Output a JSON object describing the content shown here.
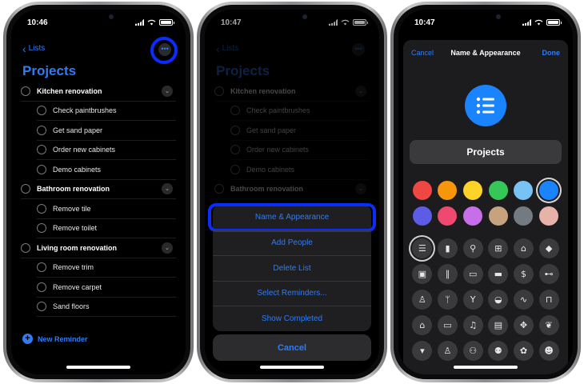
{
  "panel1": {
    "time": "10:46",
    "back_label": "Lists",
    "more_label": "•••",
    "title": "Projects",
    "rows": [
      {
        "label": "Kitchen renovation",
        "type": "parent"
      },
      {
        "label": "Check paintbrushes",
        "type": "child"
      },
      {
        "label": "Get sand paper",
        "type": "child"
      },
      {
        "label": "Order new cabinets",
        "type": "child"
      },
      {
        "label": "Demo cabinets",
        "type": "child"
      },
      {
        "label": "Bathroom renovation",
        "type": "parent"
      },
      {
        "label": "Remove tile",
        "type": "child"
      },
      {
        "label": "Remove toilet",
        "type": "child"
      },
      {
        "label": "Living room renovation",
        "type": "parent"
      },
      {
        "label": "Remove trim",
        "type": "child"
      },
      {
        "label": "Remove carpet",
        "type": "child"
      },
      {
        "label": "Sand floors",
        "type": "child"
      }
    ],
    "new_reminder": "New Reminder"
  },
  "panel2": {
    "time": "10:47",
    "back_label": "Lists",
    "more_label": "•••",
    "title": "Projects",
    "rows": [
      {
        "label": "Kitchen renovation",
        "type": "parent"
      },
      {
        "label": "Check paintbrushes",
        "type": "child"
      },
      {
        "label": "Get sand paper",
        "type": "child"
      },
      {
        "label": "Order new cabinets",
        "type": "child"
      },
      {
        "label": "Demo cabinets",
        "type": "child"
      },
      {
        "label": "Bathroom renovation",
        "type": "parent"
      }
    ],
    "sheet": [
      "Name & Appearance",
      "Add People",
      "Delete List",
      "Select Reminders...",
      "Show Completed"
    ],
    "cancel": "Cancel"
  },
  "panel3": {
    "time": "10:47",
    "cancel": "Cancel",
    "title": "Name & Appearance",
    "done": "Done",
    "list_name": "Projects",
    "colors": [
      "#ef4743",
      "#f7960a",
      "#fdd32a",
      "#36c759",
      "#79c2f6",
      "#1a84ff",
      "#5d5ce6",
      "#ee4a70",
      "#c76fe8",
      "#c6a27e",
      "#747a82",
      "#e7b3a8"
    ],
    "selected_color": 5,
    "icons": [
      {
        "name": "list-icon",
        "glyph": "☰"
      },
      {
        "name": "bookmark-icon",
        "glyph": "▮"
      },
      {
        "name": "pin-icon",
        "glyph": "⚲"
      },
      {
        "name": "gift-icon",
        "glyph": "⊞"
      },
      {
        "name": "cake-icon",
        "glyph": "⌂"
      },
      {
        "name": "graduation-cap-icon",
        "glyph": "◆"
      },
      {
        "name": "backpack-icon",
        "glyph": "▣"
      },
      {
        "name": "pencil-ruler-icon",
        "glyph": "∥"
      },
      {
        "name": "credit-card-icon",
        "glyph": "▭"
      },
      {
        "name": "card-icon",
        "glyph": "▬"
      },
      {
        "name": "money-icon",
        "glyph": "$"
      },
      {
        "name": "dumbbell-icon",
        "glyph": "⊷"
      },
      {
        "name": "running-icon",
        "glyph": "♙"
      },
      {
        "name": "fork-knife-icon",
        "glyph": "ᛘ"
      },
      {
        "name": "wine-glass-icon",
        "glyph": "Y"
      },
      {
        "name": "pills-icon",
        "glyph": "◒"
      },
      {
        "name": "stethoscope-icon",
        "glyph": "∿"
      },
      {
        "name": "chair-icon",
        "glyph": "⊓"
      },
      {
        "name": "house-icon",
        "glyph": "⌂"
      },
      {
        "name": "monitor-icon",
        "glyph": "▭"
      },
      {
        "name": "music-note-icon",
        "glyph": "♫"
      },
      {
        "name": "computer-icon",
        "glyph": "▤"
      },
      {
        "name": "gamepad-icon",
        "glyph": "✥"
      },
      {
        "name": "leaf-icon",
        "glyph": "❦"
      },
      {
        "name": "carrot-icon",
        "glyph": "▾"
      },
      {
        "name": "person-icon",
        "glyph": "♙"
      },
      {
        "name": "two-people-icon",
        "glyph": "⚇"
      },
      {
        "name": "family-icon",
        "glyph": "⚉"
      },
      {
        "name": "paw-icon",
        "glyph": "✿"
      },
      {
        "name": "teddy-bear-icon",
        "glyph": "☻"
      }
    ],
    "selected_icon": 0
  }
}
